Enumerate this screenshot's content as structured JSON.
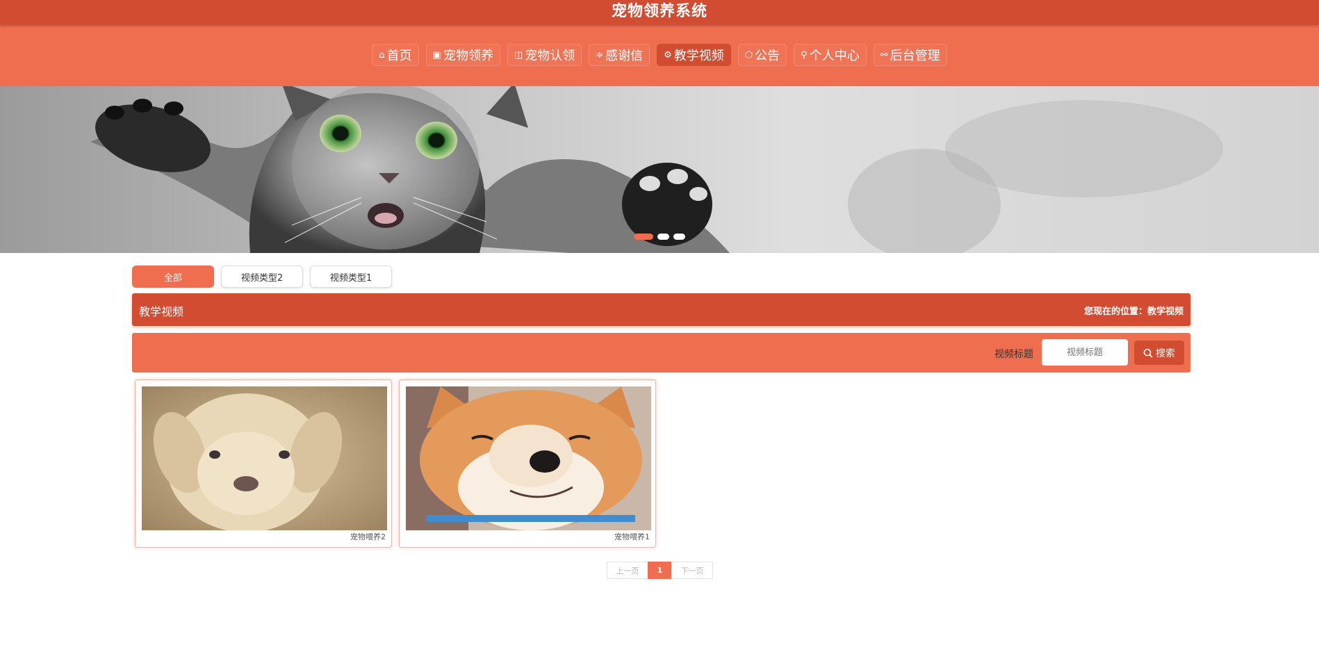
{
  "header": {
    "title": "宠物领养系统"
  },
  "nav": {
    "items": [
      {
        "label": "首页",
        "icon": "home-icon",
        "glyph": "⌂"
      },
      {
        "label": "宠物领养",
        "icon": "gift-icon",
        "glyph": "▣"
      },
      {
        "label": "宠物认领",
        "icon": "note-icon",
        "glyph": "◫"
      },
      {
        "label": "感谢信",
        "icon": "sliders-icon",
        "glyph": "≑"
      },
      {
        "label": "教学视频",
        "icon": "gear-icon",
        "glyph": "⚙"
      },
      {
        "label": "公告",
        "icon": "box-icon",
        "glyph": "⬡"
      },
      {
        "label": "个人中心",
        "icon": "user-icon",
        "glyph": "⚲"
      },
      {
        "label": "后台管理",
        "icon": "link-icon",
        "glyph": "⚯"
      }
    ],
    "active_index": 4
  },
  "banner": {
    "slide_count": 3,
    "active_slide": 1
  },
  "categories": {
    "items": [
      "全部",
      "视频类型2",
      "视频类型1"
    ],
    "active_index": 0
  },
  "breadcrumb": {
    "section": "教学视频",
    "location": "您现在的位置：教学视频"
  },
  "search": {
    "label": "视频标题",
    "placeholder": "视频标题",
    "button_label": "搜索",
    "button_icon": "search-icon"
  },
  "videos": [
    {
      "caption": "宠物喂养2",
      "image": "puppy-photo"
    },
    {
      "caption": "宠物喂养1",
      "image": "shiba-photo"
    }
  ],
  "pagination": {
    "prev": "上一页",
    "current": "1",
    "next": "下一页"
  },
  "colors": {
    "primary": "#d24c31",
    "accent": "#f06e50"
  }
}
